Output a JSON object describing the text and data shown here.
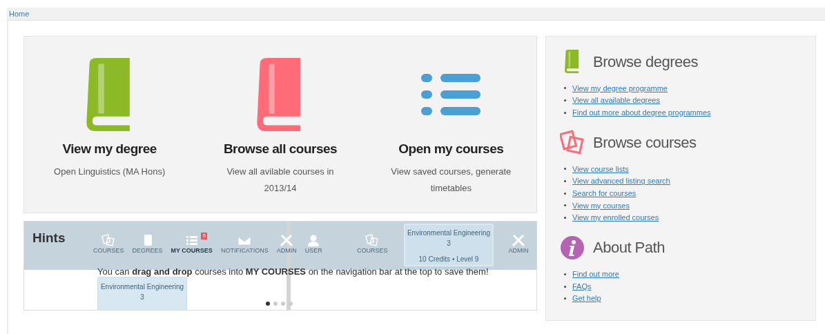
{
  "breadcrumb": {
    "label": "Home"
  },
  "tiles": [
    {
      "kind": "book",
      "color": "#8cba27",
      "title": "View my degree",
      "subtitle": "Open Linguistics (MA Hons)"
    },
    {
      "kind": "book",
      "color": "#ff6b77",
      "title": "Browse all courses",
      "subtitle": "View all avilable courses in 2013/14"
    },
    {
      "kind": "list",
      "color": "#4a9fd4",
      "title": "Open my courses",
      "subtitle": "View saved courses, generate timetables"
    }
  ],
  "hints": {
    "title": "Hints",
    "text": "You can **drag and drop** courses into **MY COURSES** on the navigation bar at the top to save them!",
    "nav_items": [
      {
        "kind": "courses",
        "label": "COURSES",
        "selected": false
      },
      {
        "kind": "degrees",
        "label": "DEGREES",
        "selected": false
      },
      {
        "kind": "mycourses",
        "label": "MY COURSES",
        "selected": true
      },
      {
        "kind": "notifications",
        "label": "NOTIFICATIONS",
        "selected": false
      },
      {
        "kind": "admin",
        "label": "ADMIN",
        "selected": false
      },
      {
        "kind": "user",
        "label": "USER",
        "selected": false
      }
    ],
    "badge": "5",
    "right_nav_items": [
      {
        "kind": "courses",
        "label": "COURSES"
      },
      {
        "kind": "admin",
        "label": "ADMIN"
      }
    ],
    "drag_cards": [
      {
        "title": "Environmental Engineering",
        "number": "3"
      },
      {
        "title": "Environmental Engineering",
        "number": "3",
        "meta": "10 Credits • Level 9"
      }
    ],
    "dots": [
      {
        "selected": true
      },
      {
        "selected": false
      },
      {
        "selected": false
      },
      {
        "selected": false
      }
    ]
  },
  "sidebar": [
    {
      "kind": "book",
      "color": "#8cba27",
      "title": "Browse degrees",
      "links": [
        "View my degree programme",
        "View all available degrees",
        "Find out more about degree programmes"
      ]
    },
    {
      "kind": "cards",
      "color": "#ff6b77",
      "title": "Browse courses",
      "links": [
        "View course lists",
        "View advanced listing search",
        "Search for courses",
        "View my courses",
        "View my enrolled courses"
      ]
    },
    {
      "kind": "info",
      "color": "#b464b0",
      "title": "About Path",
      "links": [
        "Find out more",
        "FAQs",
        "Get help"
      ]
    }
  ]
}
